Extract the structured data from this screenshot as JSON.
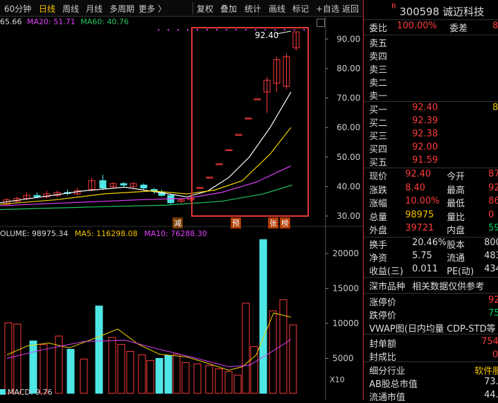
{
  "toolbar": {
    "periods": [
      "60分钟",
      "日线",
      "周线",
      "月线",
      "多周期",
      "更多 〉"
    ],
    "active_index": 1,
    "actions": [
      "复权",
      "叠加",
      "统计",
      "画线",
      "标记",
      "+自选",
      "返回"
    ]
  },
  "ma": {
    "ma5": "65.66",
    "ma20_label": "MA20:",
    "ma20": "51.71",
    "ma60_label": "MA60:",
    "ma60": "40.76"
  },
  "price_axis": [
    "90.00",
    "80.00",
    "70.00",
    "60.00",
    "50.00",
    "40.00",
    "30.00"
  ],
  "peak_label": "92.40",
  "event_tags": [
    "减",
    "预",
    "张",
    "榜"
  ],
  "volume_bar": {
    "label": "OLUME: 98975.34",
    "ma5": "MA5: 116298.08",
    "ma10": "MA10: 76288.30"
  },
  "volume_axis": [
    "20000",
    "15000",
    "10000",
    "5000"
  ],
  "volume_unit": "X10",
  "macd": "MACD: 9.76",
  "colors": {
    "up": "#ff3b3b",
    "down": "#4fe6e6",
    "ma5": "#ffffff",
    "ma10": "#f5d400",
    "ma20": "#e040fb",
    "ma60": "#22c55e",
    "highlight": "#e53935"
  },
  "panel": {
    "badge": "R",
    "code": "300598",
    "name": "诚迈科技",
    "weibi_label": "委比",
    "weibi": "100.00%",
    "weicha_label": "委差",
    "weicha": "8",
    "sells": [
      "卖五",
      "卖四",
      "卖三",
      "卖二",
      "卖一"
    ],
    "buys": [
      {
        "label": "买一",
        "price": "92.40",
        "vol": "8"
      },
      {
        "label": "买二",
        "price": "92.39",
        "vol": ""
      },
      {
        "label": "买三",
        "price": "92.38",
        "vol": ""
      },
      {
        "label": "买四",
        "price": "92.00",
        "vol": ""
      },
      {
        "label": "买五",
        "price": "91.59",
        "vol": ""
      }
    ],
    "quote": [
      {
        "l1": "现价",
        "v1": "92.40",
        "l2": "今开",
        "v2": "87"
      },
      {
        "l1": "涨跌",
        "v1": "8.40",
        "l2": "最高",
        "v2": "92"
      },
      {
        "l1": "涨幅",
        "v1": "10.00%",
        "l2": "最低",
        "v2": "86"
      },
      {
        "l1": "总量",
        "v1": "98975",
        "l2": "量比",
        "v2": "0"
      },
      {
        "l1": "外盘",
        "v1": "39721",
        "l2": "内盘",
        "v2": "59"
      }
    ],
    "stats": [
      {
        "l1": "换手",
        "v1": "20.46%",
        "l2": "股本",
        "v2": "800"
      },
      {
        "l1": "净资",
        "v1": "5.75",
        "l2": "流通",
        "v2": "483"
      },
      {
        "l1": "收益(三)",
        "v1": "0.011",
        "l2": "PE(动)",
        "v2": "434"
      }
    ],
    "section_title": "深市品种",
    "section_note": "相关数据仅供参考",
    "limit_up_label": "涨停价",
    "limit_up": "92",
    "limit_down_label": "跌停价",
    "limit_down": "75",
    "vwap": "VWAP图(日内均量 CDP-STD等",
    "seal_amount_label": "封单额",
    "seal_amount": "754",
    "seal_ratio_label": "封成比",
    "seal_ratio": "0",
    "industry_label": "细分行业",
    "industry": "软件服",
    "ab_cap_label": "AB股总市值",
    "ab_cap": "73.",
    "float_cap_label": "流通市值",
    "float_cap": "44."
  }
}
